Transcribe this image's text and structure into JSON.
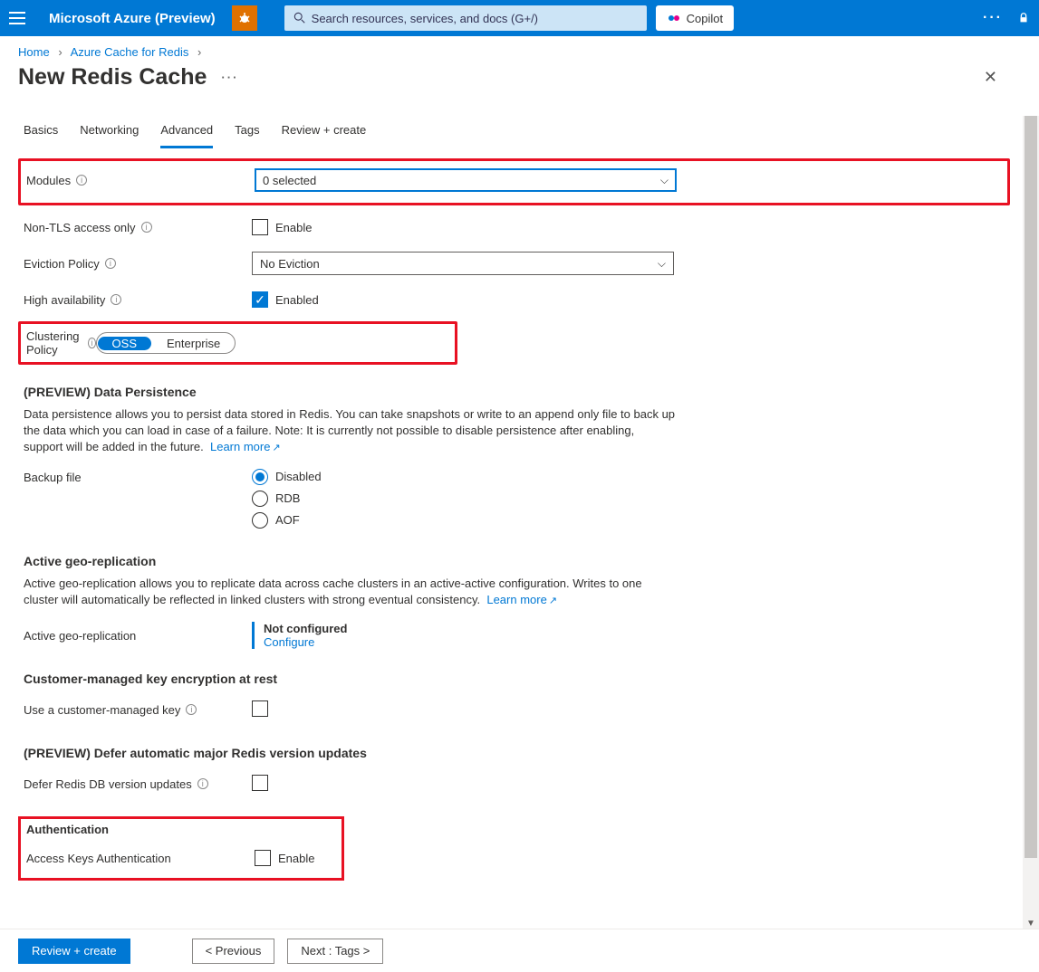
{
  "header": {
    "brand": "Microsoft Azure (Preview)",
    "search_placeholder": "Search resources, services, and docs (G+/)",
    "copilot": "Copilot"
  },
  "breadcrumbs": {
    "home": "Home",
    "service": "Azure Cache for Redis"
  },
  "page": {
    "title": "New Redis Cache"
  },
  "tabs": {
    "basics": "Basics",
    "networking": "Networking",
    "advanced": "Advanced",
    "tags": "Tags",
    "review": "Review + create"
  },
  "form": {
    "modules": {
      "label": "Modules",
      "value": "0 selected"
    },
    "nontls": {
      "label": "Non-TLS access only",
      "cb": "Enable"
    },
    "eviction": {
      "label": "Eviction Policy",
      "value": "No Eviction"
    },
    "ha": {
      "label": "High availability",
      "cb": "Enabled"
    },
    "cluster": {
      "label": "Clustering Policy",
      "opt1": "OSS",
      "opt2": "Enterprise"
    }
  },
  "persist": {
    "heading": "(PREVIEW) Data Persistence",
    "body": "Data persistence allows you to persist data stored in Redis. You can take snapshots or write to an append only file to back up the data which you can load in case of a failure. Note: It is currently not possible to disable persistence after enabling, support will be added in the future.",
    "learn": "Learn more",
    "backup_label": "Backup file",
    "opts": {
      "disabled": "Disabled",
      "rdb": "RDB",
      "aof": "AOF"
    }
  },
  "geo": {
    "heading": "Active geo-replication",
    "body": "Active geo-replication allows you to replicate data across cache clusters in an active-active configuration. Writes to one cluster will automatically be reflected in linked clusters with strong eventual consistency.",
    "learn": "Learn more",
    "label": "Active geo-replication",
    "status": "Not configured",
    "config": "Configure"
  },
  "cmk": {
    "heading": "Customer-managed key encryption at rest",
    "label": "Use a customer-managed key"
  },
  "defer": {
    "heading": "(PREVIEW) Defer automatic major Redis version updates",
    "label": "Defer Redis DB version updates"
  },
  "auth": {
    "heading": "Authentication",
    "label": "Access Keys Authentication",
    "cb": "Enable"
  },
  "footer": {
    "review": "Review + create",
    "prev": "<  Previous",
    "next": "Next : Tags  >"
  }
}
